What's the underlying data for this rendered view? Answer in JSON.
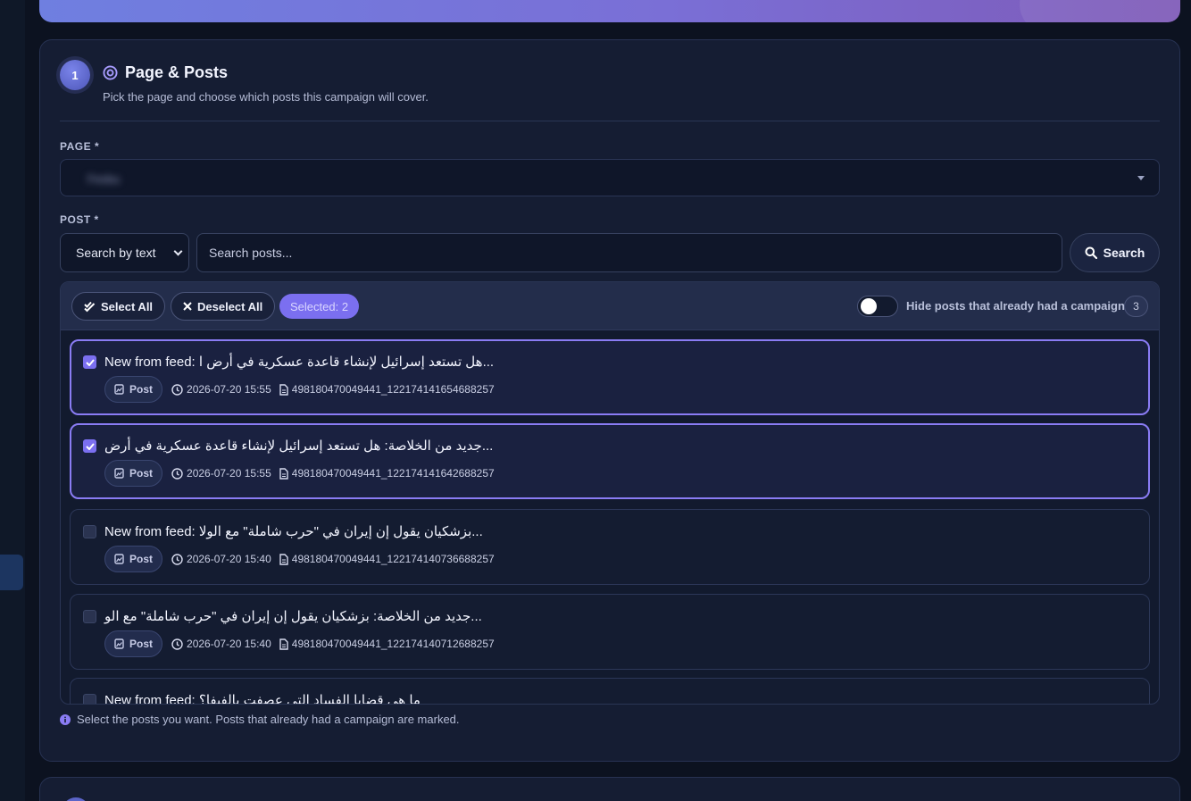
{
  "section": {
    "step_number": "1",
    "title": "Page & Posts",
    "subtitle": "Pick the page and choose which posts this campaign will cover."
  },
  "page_field": {
    "label": "PAGE *",
    "selected_value": "Fesbu"
  },
  "post_field": {
    "label": "POST *",
    "search_mode": {
      "selected": "Search by text",
      "options": [
        "Search by text"
      ]
    },
    "search_placeholder": "Search posts...",
    "search_button": "Search"
  },
  "toolbar": {
    "select_all": "Select All",
    "deselect_all": "Deselect All",
    "selected_count": "Selected: 2",
    "hide_toggle_label": "Hide posts that already had a campaign",
    "hide_toggle_on": false,
    "hidden_count": "3"
  },
  "posts": [
    {
      "title": "New from feed: هل تستعد إسرائيل لإنشاء قاعدة عسكرية في أرض ا...",
      "type": "Post",
      "datetime": "2026-07-20 15:55",
      "id": "498180470049441_122174141654688257",
      "checked": true
    },
    {
      "title": "جديد من الخلاصة: هل تستعد إسرائيل لإنشاء قاعدة عسكرية في أرض...",
      "type": "Post",
      "datetime": "2026-07-20 15:55",
      "id": "498180470049441_122174141642688257",
      "checked": true
    },
    {
      "title": "New from feed: بزشكيان يقول إن إيران في \"حرب شاملة\" مع الولا...",
      "type": "Post",
      "datetime": "2026-07-20 15:40",
      "id": "498180470049441_122174140736688257",
      "checked": false
    },
    {
      "title": "جديد من الخلاصة: بزشكيان يقول إن إيران في \"حرب شاملة\" مع الو...",
      "type": "Post",
      "datetime": "2026-07-20 15:40",
      "id": "498180470049441_122174140712688257",
      "checked": false
    },
    {
      "title": "New from feed: ما هي قضايا الفساد التي عصفت بالفيفا؟",
      "checked": false
    }
  ],
  "hint": "Select the posts you want. Posts that already had a campaign are marked.",
  "colors": {
    "accent": "#7b6ff0",
    "card_bg": "#151d33",
    "page_bg": "#0c1220",
    "hero_gradient_start": "#6f7fe0",
    "hero_gradient_end": "#7e5ab8"
  },
  "icons": {
    "section": "target-icon",
    "search": "magnifier-icon",
    "select_all": "double-check-icon",
    "deselect_all": "x-icon",
    "post_type": "document-icon",
    "time": "clock-icon",
    "id": "file-icon",
    "hint": "info-icon"
  }
}
